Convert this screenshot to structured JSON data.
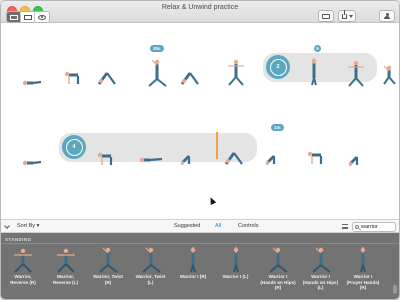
{
  "window": {
    "title": "Relax & Unwind practice"
  },
  "toolbar": {
    "view_modes": [
      "sequence-view-icon",
      "card-view-icon",
      "preview-eye-icon"
    ],
    "print_icon": "printer-icon",
    "share_icon": "share-icon",
    "account_icon": "person-icon"
  },
  "sequence": {
    "row1": {
      "badges": [
        {
          "text": "30s"
        },
        {
          "text": "5"
        },
        {
          "text": "1m"
        }
      ],
      "loop_count": "2"
    },
    "row2": {
      "loop_count": "4"
    }
  },
  "filterbar": {
    "sort_label": "Sort By",
    "tabs": [
      {
        "label": "Suggested"
      },
      {
        "label": "All"
      },
      {
        "label": "Controls"
      }
    ],
    "active_tab": "All",
    "search_value": "warrior"
  },
  "library": {
    "section": "STANDING",
    "poses": [
      {
        "line1": "Warrior,",
        "line2": "Reverse (R)"
      },
      {
        "line1": "Warrior,",
        "line2": "Reverse (L)"
      },
      {
        "line1": "Warrior, Twist",
        "line2": "(R)"
      },
      {
        "line1": "Warrior, Twist",
        "line2": "(L)"
      },
      {
        "line1": "Warrior I (R)",
        "line2": ""
      },
      {
        "line1": "Warrior I (L)",
        "line2": ""
      },
      {
        "line1": "Warrior I",
        "line2": "(Hands on Hips) (R)"
      },
      {
        "line1": "Warrior I",
        "line2": "(Hands on Hips) (L)"
      },
      {
        "line1": "Warrior I",
        "line2": "(Prayer Hands) (R)"
      }
    ]
  },
  "colors": {
    "accent": "#5ba7c2",
    "selection_bar": "#f0a23c",
    "library_bg": "#737373",
    "skin": "#e8a98c",
    "shirt": "#3d6f8c"
  }
}
